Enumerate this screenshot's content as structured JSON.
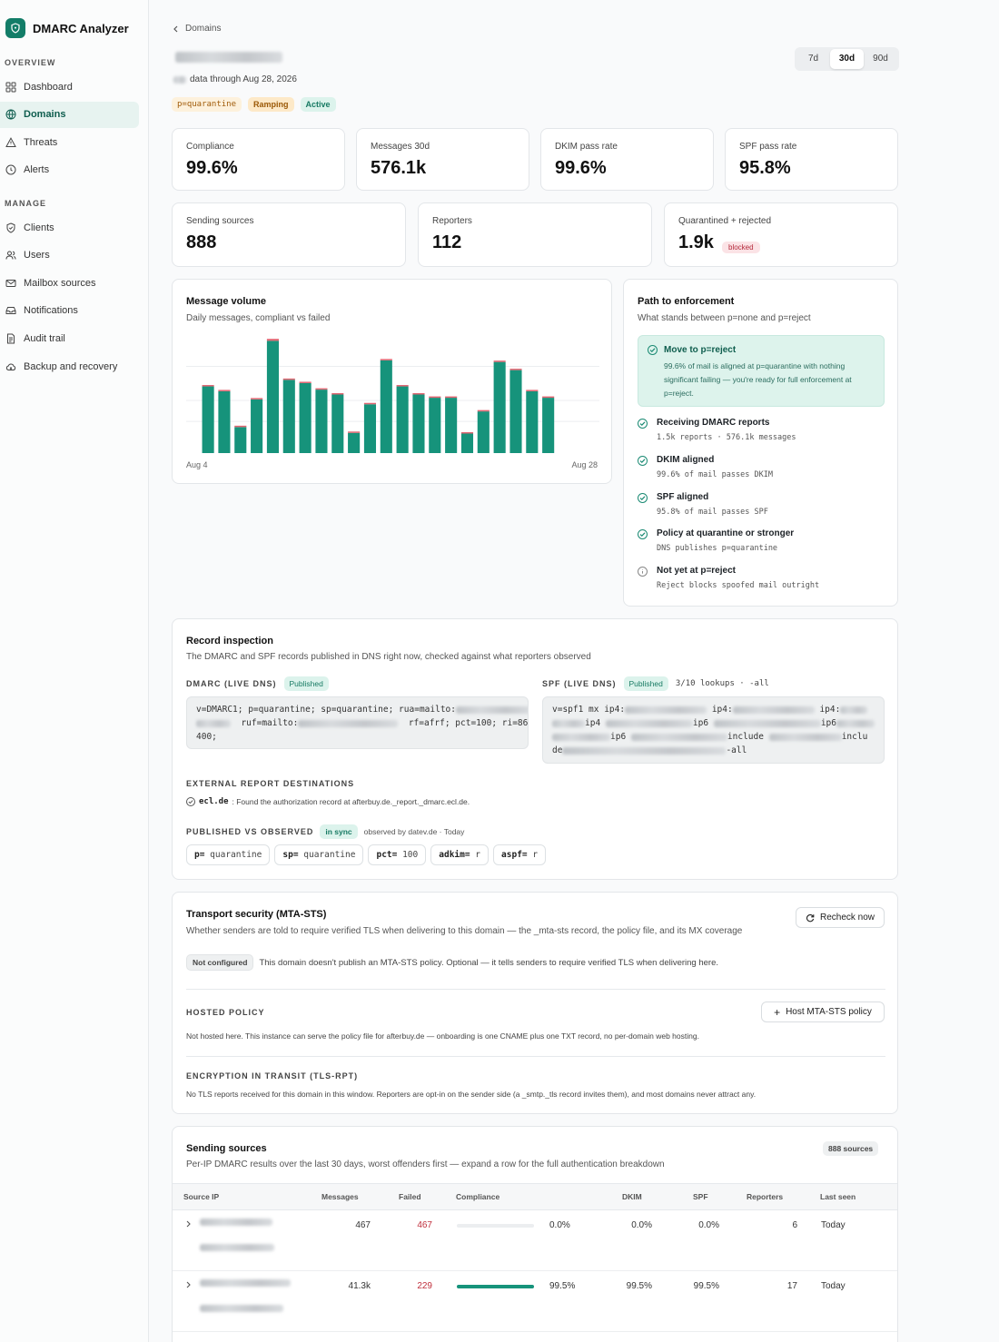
{
  "app": {
    "name": "DMARC Analyzer"
  },
  "sidebar": {
    "overview_label": "OVERVIEW",
    "manage_label": "MANAGE",
    "overview": [
      {
        "label": "Dashboard",
        "icon": "grid-icon"
      },
      {
        "label": "Domains",
        "icon": "globe-icon",
        "active": true
      },
      {
        "label": "Threats",
        "icon": "warning-icon"
      },
      {
        "label": "Alerts",
        "icon": "clock-icon"
      }
    ],
    "manage": [
      {
        "label": "Clients",
        "icon": "shield-icon"
      },
      {
        "label": "Users",
        "icon": "users-icon"
      },
      {
        "label": "Mailbox sources",
        "icon": "mail-icon"
      },
      {
        "label": "Notifications",
        "icon": "inbox-icon"
      },
      {
        "label": "Audit trail",
        "icon": "document-icon"
      },
      {
        "label": "Backup and recovery",
        "icon": "cloud-icon"
      }
    ]
  },
  "header": {
    "breadcrumb": "Domains",
    "data_through": "data through Aug 28, 2026",
    "badges": [
      {
        "label": "p=quarantine",
        "bg": "#fdf1dc",
        "fg": "#a15c0a",
        "mono": true
      },
      {
        "label": "Ramping",
        "bg": "#fde9c8",
        "fg": "#9a5806"
      },
      {
        "label": "Active",
        "bg": "#dcf3ec",
        "fg": "#177a63"
      }
    ],
    "ranges": [
      "7d",
      "30d",
      "90d"
    ],
    "range_selected": "30d"
  },
  "stats": {
    "compliance": {
      "label": "Compliance",
      "value": "99.6%"
    },
    "messages": {
      "label": "Messages 30d",
      "value": "576.1k"
    },
    "dkim": {
      "label": "DKIM pass rate",
      "value": "99.6%"
    },
    "spf": {
      "label": "SPF pass rate",
      "value": "95.8%"
    },
    "sources": {
      "label": "Sending sources",
      "value": "888"
    },
    "reporters": {
      "label": "Reporters",
      "value": "112"
    },
    "quarantined": {
      "label": "Quarantined + rejected",
      "value": "1.9k",
      "badge": "blocked"
    }
  },
  "volume": {
    "title": "Message volume",
    "subtitle": "Daily messages, compliant vs failed",
    "x_start": "Aug 4",
    "x_end": "Aug 28"
  },
  "chart_data": {
    "type": "bar",
    "title": "Message volume",
    "subtitle": "Daily messages, compliant vs failed",
    "categories": [
      "Aug 4",
      "Aug 5",
      "Aug 6",
      "Aug 7",
      "Aug 8",
      "Aug 9",
      "Aug 10",
      "Aug 11",
      "Aug 12",
      "Aug 13",
      "Aug 14",
      "Aug 15",
      "Aug 16",
      "Aug 17",
      "Aug 18",
      "Aug 19",
      "Aug 20",
      "Aug 21",
      "Aug 22",
      "Aug 23",
      "Aug 24",
      "Aug 25",
      "Aug 26",
      "Aug 27",
      "Aug 28"
    ],
    "series": [
      {
        "name": "compliant",
        "color": "#16937b",
        "values": [
          20.5,
          19.0,
          8.0,
          16.5,
          34.5,
          22.5,
          21.5,
          19.5,
          18.0,
          6.2,
          15.0,
          28.5,
          20.5,
          18.0,
          17.0,
          17.0,
          6.0,
          12.8,
          28.0,
          25.5,
          19.0,
          17.0,
          0,
          0,
          0
        ]
      },
      {
        "name": "failed",
        "color": "#e06470",
        "values": [
          0.3,
          0.4,
          0.1,
          0.1,
          0.6,
          0.2,
          0.3,
          0.1,
          0.1,
          0.1,
          0.1,
          0.2,
          0.3,
          0.3,
          0.2,
          0.2,
          0.1,
          0.1,
          0.2,
          0.3,
          0.2,
          0.1,
          0,
          0,
          0
        ]
      }
    ],
    "ylim": [
      0,
      36
    ],
    "grid": true
  },
  "enforcement": {
    "title": "Path to enforcement",
    "subtitle": "What stands between p=none and p=reject",
    "callout_title": "Move to p=reject",
    "callout_body": "99.6% of mail is aligned at p=quarantine with nothing significant failing — you're ready for full enforcement at p=reject.",
    "items": [
      {
        "title": "Receiving DMARC reports",
        "detail": "1.5k reports · 576.1k messages",
        "done": true
      },
      {
        "title": "DKIM aligned",
        "detail": "99.6% of mail passes DKIM",
        "done": true
      },
      {
        "title": "SPF aligned",
        "detail": "95.8% of mail passes SPF",
        "done": true
      },
      {
        "title": "Policy at quarantine or stronger",
        "detail": "DNS publishes p=quarantine",
        "done": true
      },
      {
        "title": "Not yet at p=reject",
        "detail": "Reject blocks spoofed mail outright",
        "done": false
      }
    ]
  },
  "record": {
    "title": "Record inspection",
    "subtitle": "The DMARC and SPF records published in DNS right now, checked against what reporters observed",
    "dmarc_label": "DMARC (LIVE DNS)",
    "dmarc_status": "Published",
    "dmarc_line1": "v=DMARC1; p=quarantine; sp=quarantine; rua=mailto:",
    "dmarc_line2a": "ruf=mailto:",
    "dmarc_line2b": "rf=afrf; pct=100; ri=86",
    "dmarc_line3": "400;",
    "spf_label": "SPF (LIVE DNS)",
    "spf_status": "Published",
    "spf_lookups": "3/10 lookups · -all",
    "spf_l1a": "v=spf1 mx ip4:",
    "spf_l1b": "ip4:",
    "spf_l1c": "ip4:",
    "spf_l2a": "ip4",
    "spf_l2b": "ip6",
    "spf_l2c": "ip6",
    "spf_l3a": "ip6",
    "spf_l3b": "include",
    "spf_l3c": "inclu",
    "spf_l4a": "de",
    "spf_l4b": "-all",
    "ext_label": "EXTERNAL REPORT DESTINATIONS",
    "ext_domain": "ecl.de",
    "ext_text": ": Found the authorization record at afterbuy.de._report._dmarc.ecl.de.",
    "pvo_label": "PUBLISHED VS OBSERVED",
    "pvo_status": "in sync",
    "pvo_observed": "observed by datev.de · Today",
    "tags": [
      {
        "k": "p=",
        "v": "quarantine"
      },
      {
        "k": "sp=",
        "v": "quarantine"
      },
      {
        "k": "pct=",
        "v": "100"
      },
      {
        "k": "adkim=",
        "v": "r"
      },
      {
        "k": "aspf=",
        "v": "r"
      }
    ]
  },
  "mtasts": {
    "title": "Transport security (MTA-STS)",
    "subtitle": "Whether senders are told to require verified TLS when delivering to this domain — the _mta-sts record, the policy file, and its MX coverage",
    "recheck": "Recheck now",
    "status": "Not configured",
    "status_text": "This domain doesn't publish an MTA-STS policy. Optional — it tells senders to require verified TLS when delivering here.",
    "hosted_label": "HOSTED POLICY",
    "hosted_button": "Host MTA-STS policy",
    "hosted_text": "Not hosted here. This instance can serve the policy file for afterbuy.de — onboarding is one CNAME plus one TXT record, no per-domain web hosting.",
    "tls_label": "ENCRYPTION IN TRANSIT (TLS-RPT)",
    "tls_text": "No TLS reports received for this domain in this window. Reporters are opt-in on the sender side (a _smtp._tls record invites them), and most domains never attract any."
  },
  "sources": {
    "title": "Sending sources",
    "subtitle": "Per-IP DMARC results over the last 30 days, worst offenders first — expand a row for the full authentication breakdown",
    "count": "888 sources",
    "columns": [
      "Source IP",
      "Messages",
      "Failed",
      "Compliance",
      "DKIM",
      "SPF",
      "Reporters",
      "Last seen"
    ],
    "rows": [
      {
        "messages": "467",
        "failed": "467",
        "compliance": "0.0%",
        "compliance_fraction": 0.0,
        "dkim": "0.0%",
        "spf": "0.0%",
        "reporters": "6",
        "last_seen": "Today"
      },
      {
        "messages": "41.3k",
        "failed": "229",
        "compliance": "99.5%",
        "compliance_fraction": 0.995,
        "dkim": "99.5%",
        "spf": "99.5%",
        "reporters": "17",
        "last_seen": "Today"
      }
    ]
  },
  "colors": {
    "accent": "#137d68",
    "fail": "#c0303d",
    "bar": "#16937b"
  }
}
